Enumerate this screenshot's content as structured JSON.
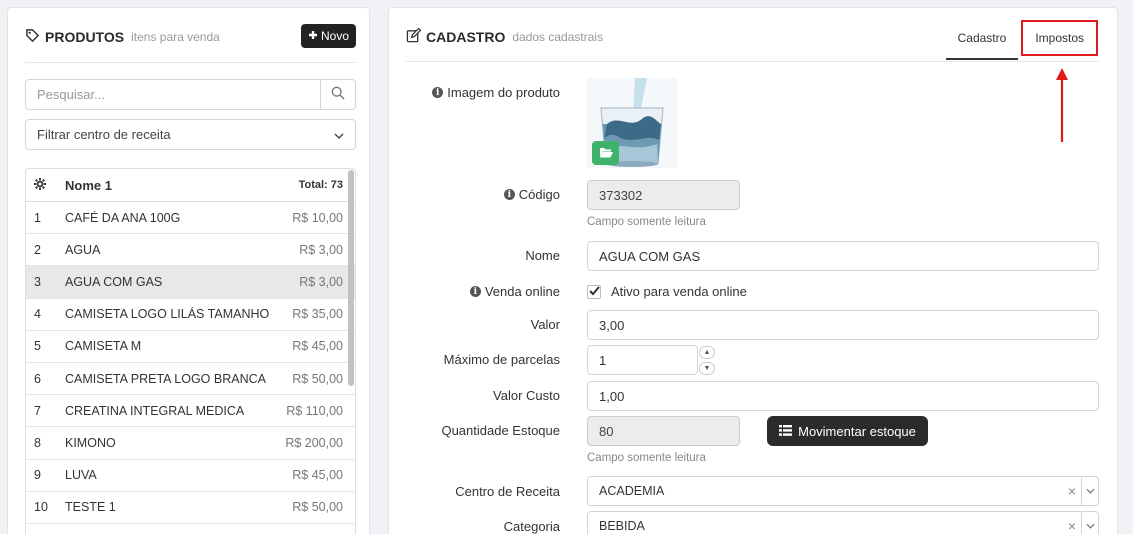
{
  "left": {
    "title": "PRODUTOS",
    "subtitle": "itens para venda",
    "new_button": "Novo",
    "search_placeholder": "Pesquisar...",
    "filter_label": "Filtrar centro de receita",
    "table": {
      "col_name": "Nome 1",
      "total": "Total: 73",
      "rows": [
        {
          "n": "1",
          "name": "CAFÉ DA ANA 100G",
          "price": "R$ 10,00"
        },
        {
          "n": "2",
          "name": "AGUA",
          "price": "R$ 3,00"
        },
        {
          "n": "3",
          "name": "AGUA COM GAS",
          "price": "R$ 3,00"
        },
        {
          "n": "4",
          "name": "CAMISETA LOGO LILÁS TAMANHO P",
          "price": "R$ 35,00"
        },
        {
          "n": "5",
          "name": "CAMISETA M",
          "price": "R$ 45,00"
        },
        {
          "n": "6",
          "name": "CAMISETA PRETA LOGO BRANCA",
          "price": "R$ 50,00"
        },
        {
          "n": "7",
          "name": "CREATINA INTEGRAL MEDICA",
          "price": "R$ 110,00"
        },
        {
          "n": "8",
          "name": "KIMONO",
          "price": "R$ 200,00"
        },
        {
          "n": "9",
          "name": "LUVA",
          "price": "R$ 45,00"
        },
        {
          "n": "10",
          "name": "TESTE 1",
          "price": "R$ 50,00"
        }
      ]
    }
  },
  "right": {
    "title": "CADASTRO",
    "subtitle": "dados cadastrais",
    "tabs": [
      {
        "label": "Cadastro"
      },
      {
        "label": "Impostos"
      }
    ],
    "form": {
      "image_label": "Imagem do produto",
      "code_label": "Código",
      "code_value": "373302",
      "readonly_hint": "Campo somente leitura",
      "name_label": "Nome",
      "name_value": "AGUA COM GAS",
      "online_label": "Venda online",
      "online_check_label": "Ativo para venda online",
      "value_label": "Valor",
      "value_value": "3,00",
      "parcelas_label": "Máximo de parcelas",
      "parcelas_value": "1",
      "cost_label": "Valor Custo",
      "cost_value": "1,00",
      "stock_label": "Quantidade Estoque",
      "stock_value": "80",
      "stock_button": "Movimentar estoque",
      "stock_hint": "Campo somente leitura",
      "center_label": "Centro de Receita",
      "center_value": "ACADEMIA",
      "category_label": "Categoria",
      "category_value": "BEBIDA"
    }
  },
  "colors": {
    "highlight": "#e0191b",
    "dark_button": "#222222",
    "folder_button": "#3fb36b",
    "selected_row": "#e8e8e8"
  }
}
